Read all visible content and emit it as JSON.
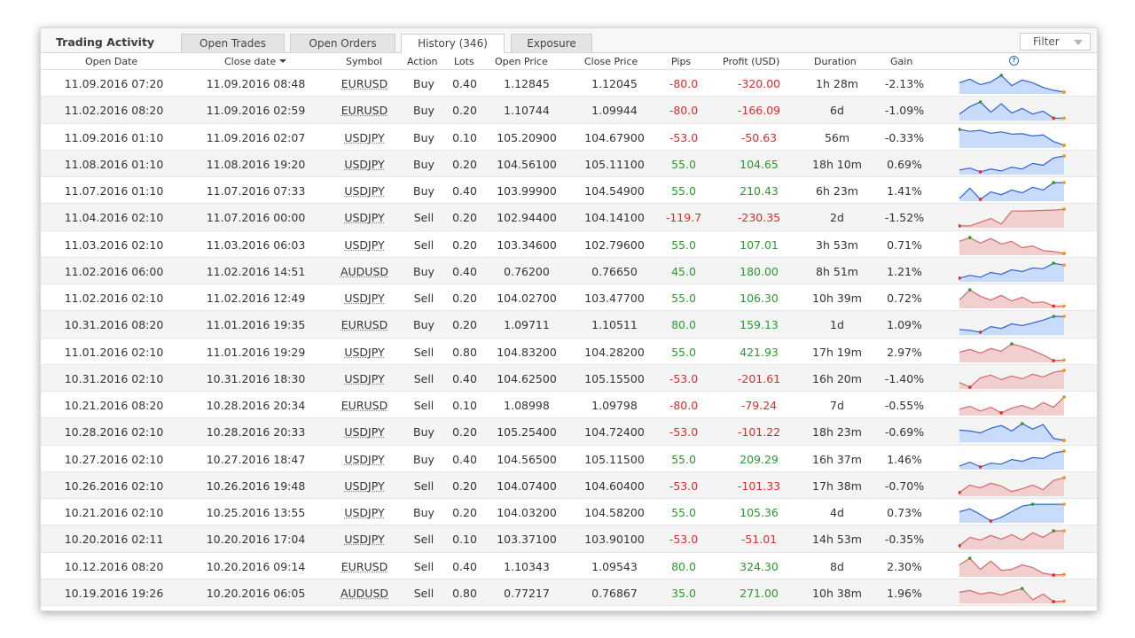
{
  "header": {
    "title": "Trading Activity",
    "tabs": [
      {
        "label": "Open Trades",
        "active": false
      },
      {
        "label": "Open Orders",
        "active": false
      },
      {
        "label": "History (346)",
        "active": true
      },
      {
        "label": "Exposure",
        "active": false
      }
    ],
    "filter_label": "Filter"
  },
  "columns": {
    "open_date": "Open Date",
    "close_date": "Close date",
    "symbol": "Symbol",
    "action": "Action",
    "lots": "Lots",
    "open_price": "Open Price",
    "close_price": "Close Price",
    "pips": "Pips",
    "profit": "Profit (USD)",
    "duration": "Duration",
    "gain": "Gain",
    "chart_icon": "help-circle-icon"
  },
  "colors": {
    "positive": "#2a9a2a",
    "negative": "#e02a2a",
    "spark_buy_fill": "#c9dbfb",
    "spark_buy_line": "#2f62d8",
    "spark_sell_fill": "#f1cfcf",
    "spark_sell_line": "#d46a6a"
  },
  "rows": [
    {
      "open": "11.09.2016 07:20",
      "close": "11.09.2016 08:48",
      "symbol": "EURUSD",
      "action": "Buy",
      "lots": "0.40",
      "open_price": "1.12845",
      "close_price": "1.12045",
      "pips": "-80.0",
      "profit": "-320.00",
      "duration": "1h 28m",
      "gain": "-2.13%",
      "spark": [
        0.55,
        0.75,
        0.45,
        0.6,
        0.95,
        0.4,
        0.7,
        0.55,
        0.3,
        0.15,
        0.05
      ]
    },
    {
      "open": "11.02.2016 08:20",
      "close": "11.09.2016 02:59",
      "symbol": "EURUSD",
      "action": "Buy",
      "lots": "0.20",
      "open_price": "1.10744",
      "close_price": "1.09944",
      "pips": "-80.0",
      "profit": "-166.09",
      "duration": "6d",
      "gain": "-1.09%",
      "spark": [
        0.3,
        0.7,
        0.95,
        0.4,
        0.85,
        0.35,
        0.6,
        0.3,
        0.45,
        0.08,
        0.08
      ]
    },
    {
      "open": "11.09.2016 01:10",
      "close": "11.09.2016 02:07",
      "symbol": "USDJPY",
      "action": "Buy",
      "lots": "0.10",
      "open_price": "105.20900",
      "close_price": "104.67900",
      "pips": "-53.0",
      "profit": "-50.63",
      "duration": "56m",
      "gain": "-0.33%",
      "spark": [
        0.95,
        0.85,
        0.9,
        0.75,
        0.82,
        0.7,
        0.72,
        0.6,
        0.65,
        0.3,
        0.1
      ]
    },
    {
      "open": "11.08.2016 01:10",
      "close": "11.08.2016 19:20",
      "symbol": "USDJPY",
      "action": "Buy",
      "lots": "0.20",
      "open_price": "104.56100",
      "close_price": "105.11100",
      "pips": "55.0",
      "profit": "104.65",
      "duration": "18h 10m",
      "gain": "0.69%",
      "spark": [
        0.2,
        0.3,
        0.1,
        0.25,
        0.15,
        0.35,
        0.25,
        0.55,
        0.45,
        0.85,
        0.95
      ]
    },
    {
      "open": "11.07.2016 01:10",
      "close": "11.07.2016 07:33",
      "symbol": "USDJPY",
      "action": "Buy",
      "lots": "0.40",
      "open_price": "103.99900",
      "close_price": "104.54900",
      "pips": "55.0",
      "profit": "210.43",
      "duration": "6h 23m",
      "gain": "1.41%",
      "spark": [
        0.1,
        0.65,
        0.05,
        0.45,
        0.3,
        0.55,
        0.4,
        0.7,
        0.55,
        0.95,
        0.95
      ]
    },
    {
      "open": "11.04.2016 02:10",
      "close": "11.07.2016 00:00",
      "symbol": "USDJPY",
      "action": "Sell",
      "lots": "0.20",
      "open_price": "102.94400",
      "close_price": "104.14100",
      "pips": "-119.7",
      "profit": "-230.35",
      "duration": "2d",
      "gain": "-1.52%",
      "spark": [
        0.05,
        0.05,
        0.25,
        0.45,
        0.15,
        0.85,
        0.85,
        0.86,
        0.88,
        0.9,
        0.95
      ]
    },
    {
      "open": "11.03.2016 02:10",
      "close": "11.03.2016 06:03",
      "symbol": "USDJPY",
      "action": "Sell",
      "lots": "0.20",
      "open_price": "103.34600",
      "close_price": "102.79600",
      "pips": "55.0",
      "profit": "107.01",
      "duration": "3h 53m",
      "gain": "0.71%",
      "spark": [
        0.7,
        0.9,
        0.6,
        0.85,
        0.55,
        0.7,
        0.35,
        0.45,
        0.2,
        0.15,
        0.05
      ]
    },
    {
      "open": "11.02.2016 06:00",
      "close": "11.02.2016 14:51",
      "symbol": "AUDUSD",
      "action": "Buy",
      "lots": "0.40",
      "open_price": "0.76200",
      "close_price": "0.76650",
      "pips": "45.0",
      "profit": "180.00",
      "duration": "8h 51m",
      "gain": "1.21%",
      "spark": [
        0.15,
        0.3,
        0.2,
        0.45,
        0.35,
        0.6,
        0.5,
        0.7,
        0.65,
        0.95,
        0.85
      ]
    },
    {
      "open": "11.02.2016 02:10",
      "close": "11.02.2016 12:49",
      "symbol": "USDJPY",
      "action": "Sell",
      "lots": "0.20",
      "open_price": "104.02700",
      "close_price": "103.47700",
      "pips": "55.0",
      "profit": "106.30",
      "duration": "10h 39m",
      "gain": "0.72%",
      "spark": [
        0.4,
        0.95,
        0.6,
        0.4,
        0.65,
        0.35,
        0.55,
        0.25,
        0.3,
        0.08,
        0.08
      ]
    },
    {
      "open": "10.31.2016 08:20",
      "close": "11.01.2016 19:35",
      "symbol": "EURUSD",
      "action": "Buy",
      "lots": "0.20",
      "open_price": "1.09711",
      "close_price": "1.10511",
      "pips": "80.0",
      "profit": "159.13",
      "duration": "1d",
      "gain": "1.09%",
      "spark": [
        0.25,
        0.2,
        0.1,
        0.4,
        0.3,
        0.55,
        0.45,
        0.6,
        0.75,
        0.95,
        0.95
      ]
    },
    {
      "open": "11.01.2016 02:10",
      "close": "11.01.2016 19:29",
      "symbol": "USDJPY",
      "action": "Sell",
      "lots": "0.80",
      "open_price": "104.83200",
      "close_price": "104.28200",
      "pips": "55.0",
      "profit": "421.93",
      "duration": "17h 19m",
      "gain": "2.97%",
      "spark": [
        0.5,
        0.65,
        0.45,
        0.7,
        0.55,
        0.95,
        0.8,
        0.6,
        0.35,
        0.05,
        0.08
      ]
    },
    {
      "open": "10.31.2016 02:10",
      "close": "10.31.2016 18:30",
      "symbol": "USDJPY",
      "action": "Sell",
      "lots": "0.40",
      "open_price": "104.62500",
      "close_price": "105.15500",
      "pips": "-53.0",
      "profit": "-201.61",
      "duration": "16h 20m",
      "gain": "-1.40%",
      "spark": [
        0.3,
        0.05,
        0.55,
        0.7,
        0.45,
        0.65,
        0.5,
        0.75,
        0.6,
        0.85,
        0.95
      ]
    },
    {
      "open": "10.21.2016 08:20",
      "close": "10.28.2016 20:34",
      "symbol": "EURUSD",
      "action": "Sell",
      "lots": "0.10",
      "open_price": "1.08998",
      "close_price": "1.09798",
      "pips": "-80.0",
      "profit": "-79.24",
      "duration": "7d",
      "gain": "-0.55%",
      "spark": [
        0.3,
        0.45,
        0.2,
        0.4,
        0.1,
        0.35,
        0.5,
        0.3,
        0.65,
        0.4,
        0.95
      ]
    },
    {
      "open": "10.28.2016 02:10",
      "close": "10.28.2016 20:33",
      "symbol": "USDJPY",
      "action": "Buy",
      "lots": "0.20",
      "open_price": "105.25400",
      "close_price": "104.72400",
      "pips": "-53.0",
      "profit": "-101.22",
      "duration": "18h 23m",
      "gain": "-0.69%",
      "spark": [
        0.6,
        0.55,
        0.45,
        0.7,
        0.85,
        0.55,
        0.95,
        0.65,
        0.9,
        0.15,
        0.05
      ]
    },
    {
      "open": "10.27.2016 02:10",
      "close": "10.27.2016 18:47",
      "symbol": "USDJPY",
      "action": "Buy",
      "lots": "0.40",
      "open_price": "104.56500",
      "close_price": "105.11500",
      "pips": "55.0",
      "profit": "209.29",
      "duration": "16h 37m",
      "gain": "1.46%",
      "spark": [
        0.15,
        0.35,
        0.1,
        0.3,
        0.25,
        0.5,
        0.4,
        0.6,
        0.55,
        0.85,
        0.95
      ]
    },
    {
      "open": "10.26.2016 02:10",
      "close": "10.26.2016 19:48",
      "symbol": "USDJPY",
      "action": "Sell",
      "lots": "0.20",
      "open_price": "104.07400",
      "close_price": "104.60400",
      "pips": "-53.0",
      "profit": "-101.33",
      "duration": "17h 38m",
      "gain": "-0.70%",
      "spark": [
        0.15,
        0.55,
        0.4,
        0.65,
        0.5,
        0.2,
        0.35,
        0.55,
        0.3,
        0.8,
        0.95
      ]
    },
    {
      "open": "10.21.2016 02:10",
      "close": "10.25.2016 13:55",
      "symbol": "USDJPY",
      "action": "Buy",
      "lots": "0.20",
      "open_price": "104.03200",
      "close_price": "104.58200",
      "pips": "55.0",
      "profit": "105.36",
      "duration": "4d",
      "gain": "0.73%",
      "spark": [
        0.55,
        0.7,
        0.4,
        0.05,
        0.25,
        0.55,
        0.85,
        0.95,
        0.95,
        0.95,
        0.95
      ]
    },
    {
      "open": "10.20.2016 02:11",
      "close": "10.20.2016 17:04",
      "symbol": "USDJPY",
      "action": "Sell",
      "lots": "0.10",
      "open_price": "103.37100",
      "close_price": "103.90100",
      "pips": "-53.0",
      "profit": "-51.01",
      "duration": "14h 53m",
      "gain": "-0.35%",
      "spark": [
        0.15,
        0.6,
        0.45,
        0.7,
        0.5,
        0.75,
        0.45,
        0.85,
        0.6,
        0.95,
        0.95
      ]
    },
    {
      "open": "10.12.2016 08:20",
      "close": "10.20.2016 09:14",
      "symbol": "EURUSD",
      "action": "Sell",
      "lots": "0.40",
      "open_price": "1.10343",
      "close_price": "1.09543",
      "pips": "80.0",
      "profit": "324.30",
      "duration": "8d",
      "gain": "2.30%",
      "spark": [
        0.6,
        0.95,
        0.35,
        0.8,
        0.3,
        0.35,
        0.6,
        0.45,
        0.15,
        0.05,
        0.08
      ]
    },
    {
      "open": "10.19.2016 19:26",
      "close": "10.20.2016 06:05",
      "symbol": "AUDUSD",
      "action": "Sell",
      "lots": "0.80",
      "open_price": "0.77217",
      "close_price": "0.76867",
      "pips": "35.0",
      "profit": "271.00",
      "duration": "10h 38m",
      "gain": "1.96%",
      "spark": [
        0.55,
        0.65,
        0.45,
        0.55,
        0.4,
        0.6,
        0.75,
        0.15,
        0.45,
        0.05,
        0.08
      ]
    }
  ]
}
